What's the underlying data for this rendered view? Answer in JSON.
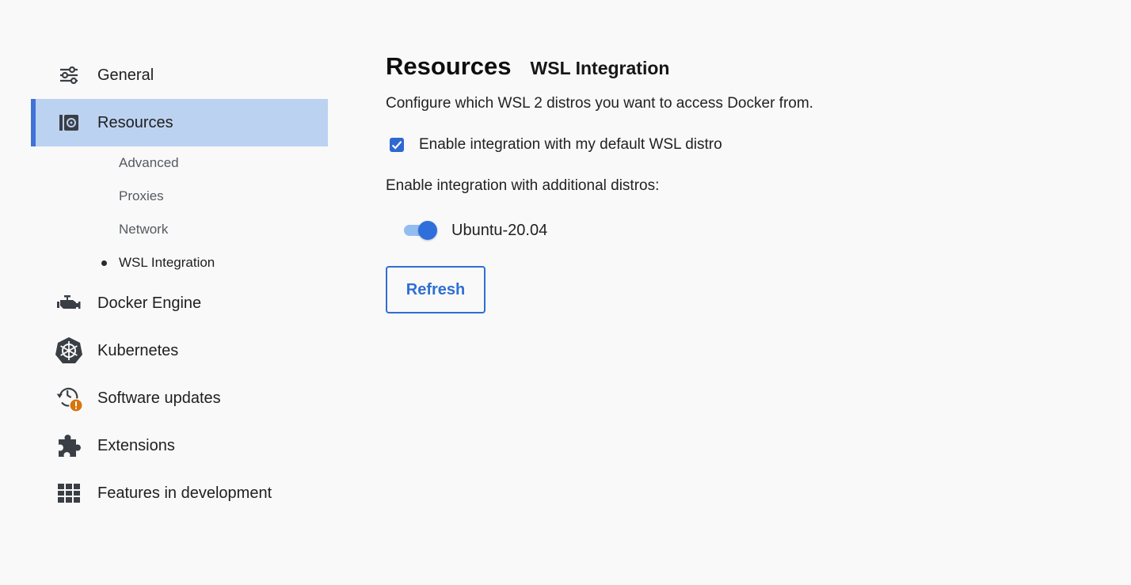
{
  "sidebar": {
    "items": [
      {
        "label": "General",
        "icon": "sliders-icon"
      },
      {
        "label": "Resources",
        "icon": "resources-icon"
      },
      {
        "label": "Docker Engine",
        "icon": "engine-icon"
      },
      {
        "label": "Kubernetes",
        "icon": "kubernetes-icon"
      },
      {
        "label": "Software updates",
        "icon": "history-icon"
      },
      {
        "label": "Extensions",
        "icon": "puzzle-icon"
      },
      {
        "label": "Features in development",
        "icon": "grid-icon"
      }
    ],
    "sub_items": [
      {
        "label": "Advanced"
      },
      {
        "label": "Proxies"
      },
      {
        "label": "Network"
      },
      {
        "label": "WSL Integration"
      }
    ],
    "update_badge": "!"
  },
  "main": {
    "title": "Resources",
    "subtitle": "WSL Integration",
    "description": "Configure which WSL 2 distros you want to access Docker from.",
    "default_distro_label": "Enable integration with my default WSL distro",
    "default_distro_checked": true,
    "additional_label": "Enable integration with additional distros:",
    "distros": [
      {
        "name": "Ubuntu-20.04",
        "enabled": true
      }
    ],
    "refresh_label": "Refresh"
  },
  "colors": {
    "accent": "#2f6fd2",
    "active_bg": "#bcd2f1",
    "active_bar": "#3f73d6",
    "warning": "#d9730d",
    "icon": "#3a3f45"
  }
}
